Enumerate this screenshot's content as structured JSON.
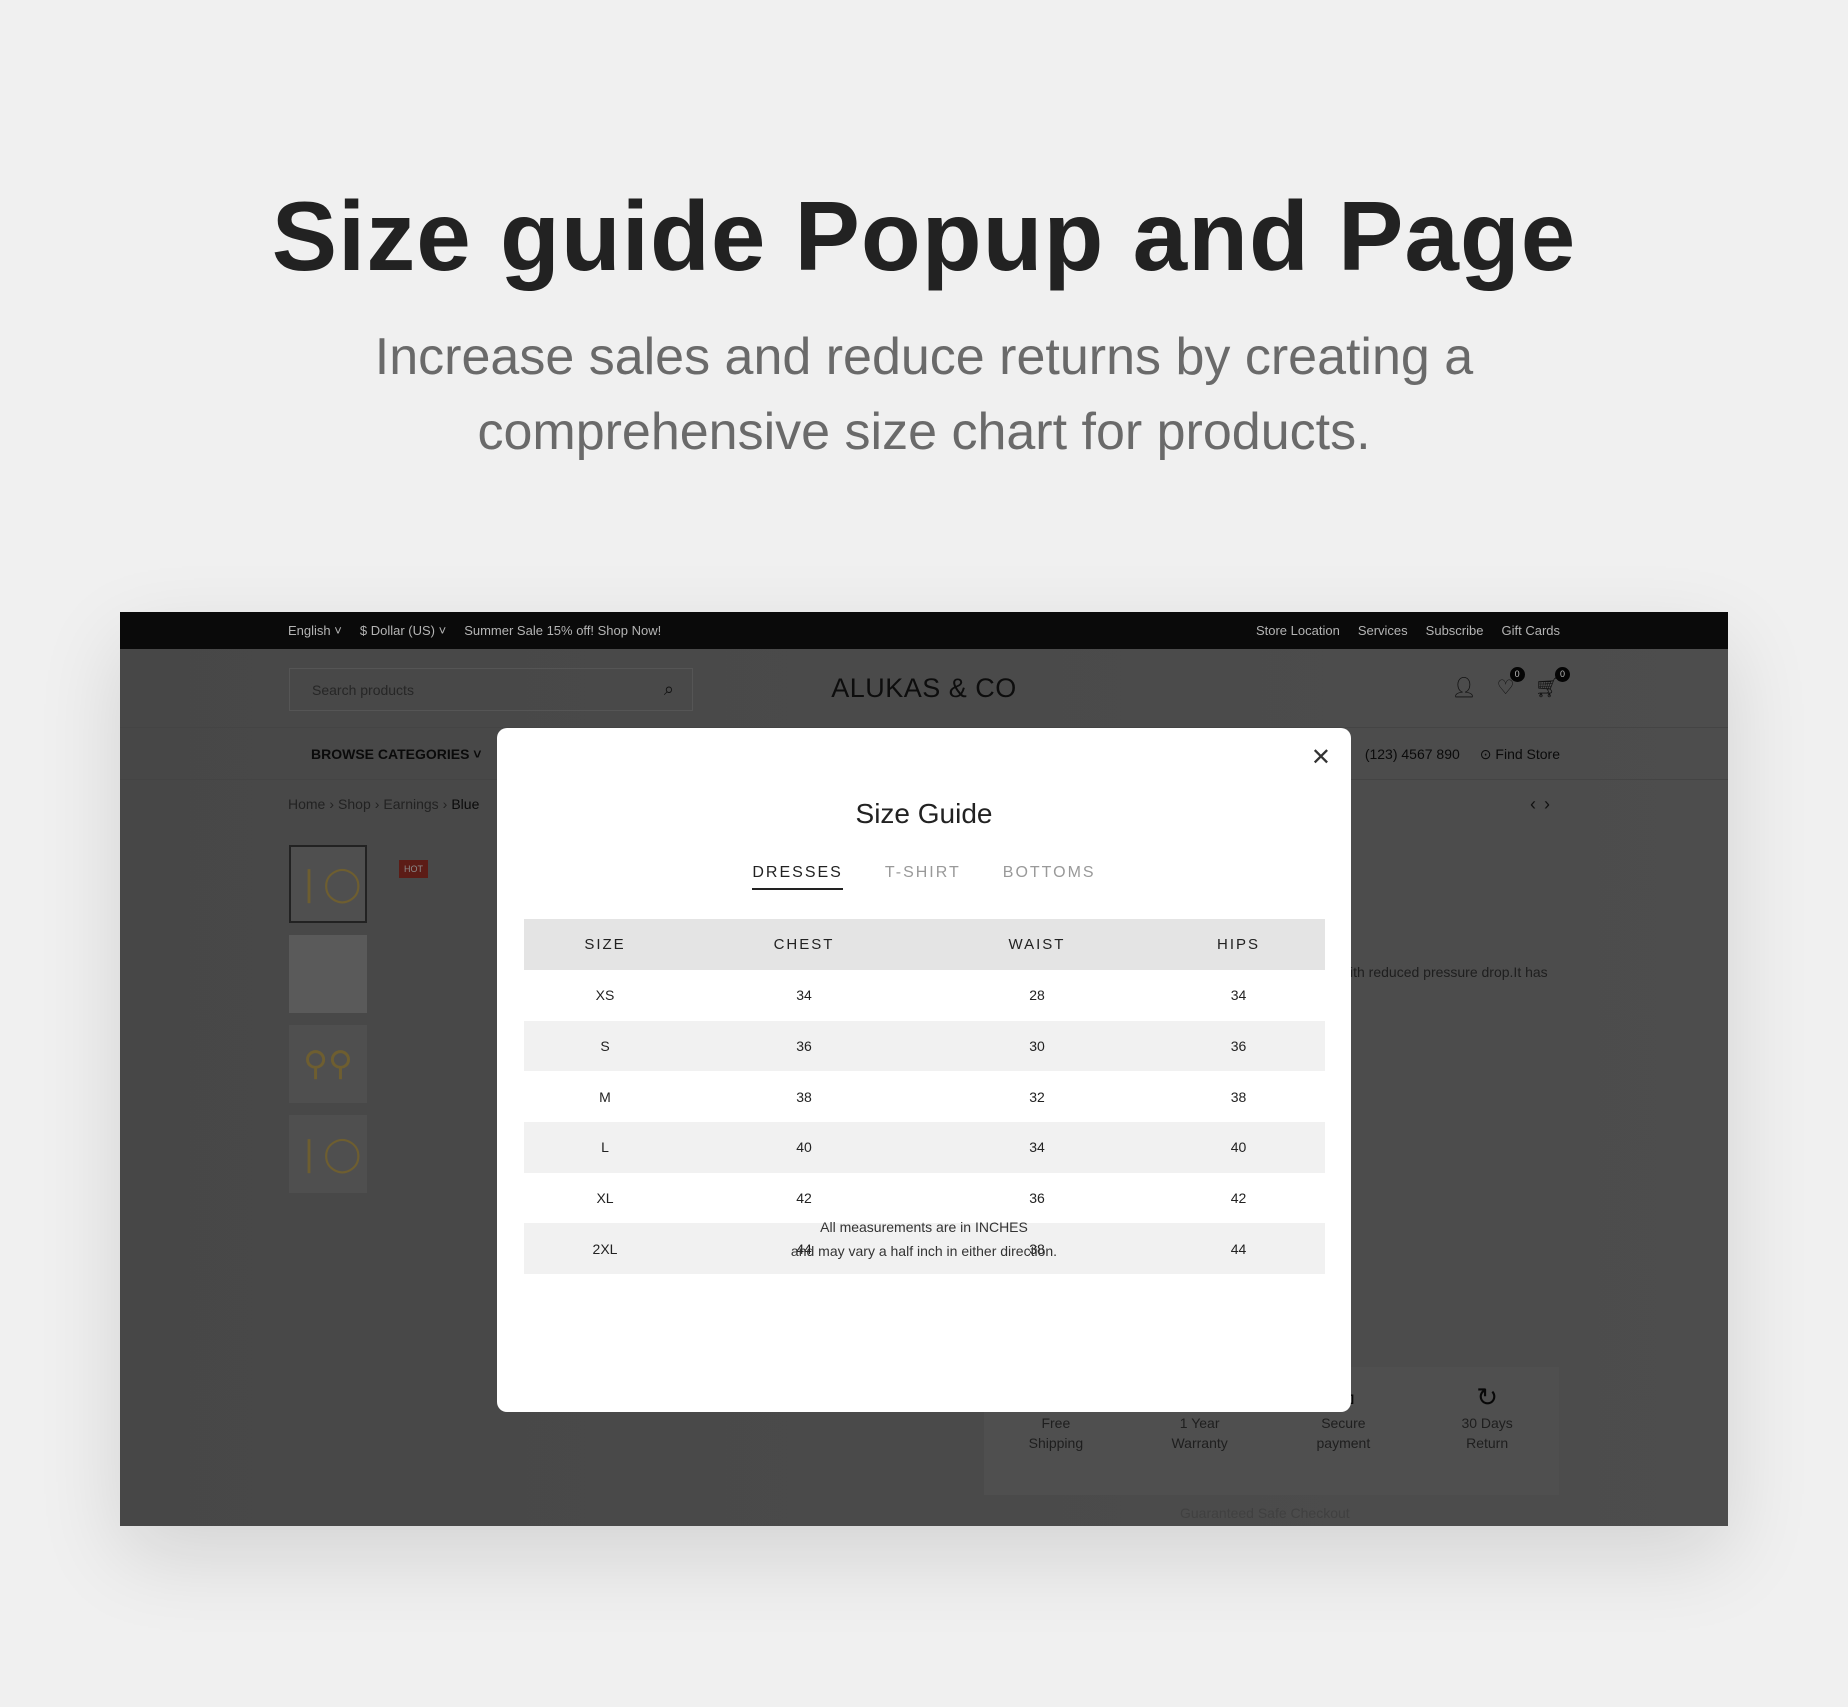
{
  "hero": {
    "title": "Size guide Popup and Page",
    "subtitle": "Increase sales and reduce returns by creating a comprehensive size chart for products."
  },
  "topbar": {
    "language": "English",
    "currency": "$ Dollar (US)",
    "promo": "Summer Sale 15% off! Shop Now!",
    "links": [
      "Store Location",
      "Services",
      "Subscribe",
      "Gift Cards"
    ]
  },
  "header": {
    "search_placeholder": "Search products",
    "logo": "ALUKAS & CO",
    "wishlist_count": "0",
    "cart_count": "0"
  },
  "nav": {
    "browse": "BROWSE CATEGORIES",
    "phone": "(123) 4567 890",
    "find_store": "Find Store"
  },
  "breadcrumb": [
    "Home",
    "Shop",
    "Earnings",
    "Blue"
  ],
  "product": {
    "badge": "HOT",
    "description_fragment": "ith reduced pressure drop.It has"
  },
  "features": [
    {
      "icon": "truck-icon",
      "line1": "Free",
      "line2": "Shipping"
    },
    {
      "icon": "shield-icon",
      "line1": "1 Year",
      "line2": "Warranty"
    },
    {
      "icon": "hand-card-icon",
      "line1": "Secure",
      "line2": "payment"
    },
    {
      "icon": "return-icon",
      "line1": "30 Days",
      "line2": "Return"
    }
  ],
  "safe_checkout": "Guaranteed Safe Checkout",
  "modal": {
    "title": "Size Guide",
    "tabs": [
      {
        "label": "DRESSES",
        "active": true
      },
      {
        "label": "T-SHIRT",
        "active": false
      },
      {
        "label": "BOTTOMS",
        "active": false
      }
    ],
    "columns": [
      "SIZE",
      "CHEST",
      "WAIST",
      "HIPS"
    ],
    "rows": [
      [
        "XS",
        "34",
        "28",
        "34"
      ],
      [
        "S",
        "36",
        "30",
        "36"
      ],
      [
        "M",
        "38",
        "32",
        "38"
      ],
      [
        "L",
        "40",
        "34",
        "40"
      ],
      [
        "XL",
        "42",
        "36",
        "42"
      ],
      [
        "2XL",
        "44",
        "38",
        "44"
      ]
    ],
    "note_line1": "All measurements are in INCHES",
    "note_line2": "and may vary a half inch in either direction."
  }
}
